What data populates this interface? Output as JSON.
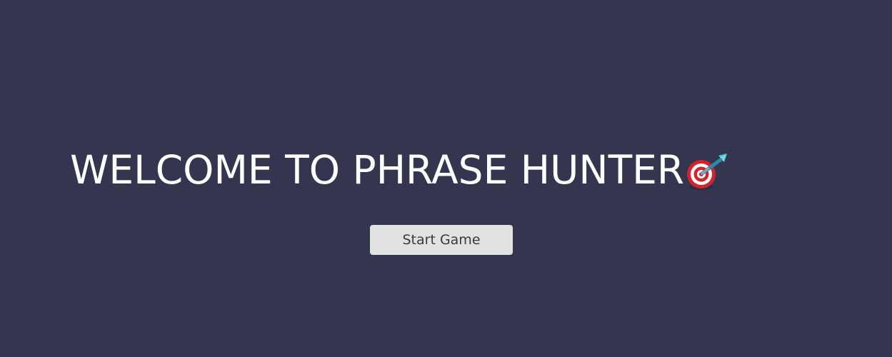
{
  "overlay": {
    "title": "WELCOME TO PHRASE HUNTER",
    "title_icon": "direct-hit-target-icon",
    "start_button_label": "Start Game"
  },
  "colors": {
    "background": "#34364f",
    "title_text": "#ffffff",
    "button_background": "#e2e2e2",
    "button_text": "#3a3a3a"
  }
}
